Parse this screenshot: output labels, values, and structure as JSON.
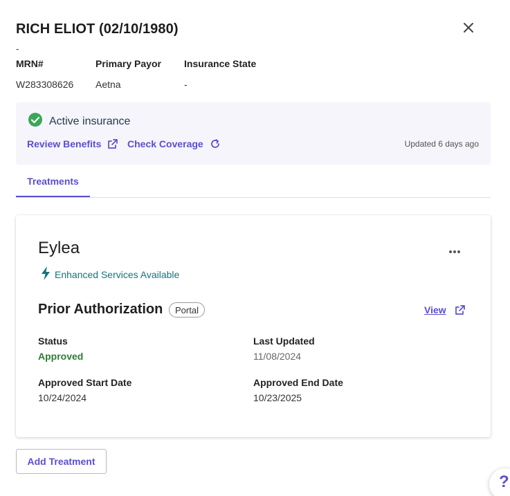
{
  "header": {
    "title": "RICH ELIOT (02/10/1980)",
    "subtitle_dash": "-"
  },
  "patient_info": {
    "mrn_label": "MRN#",
    "mrn_value": "W283308626",
    "payor_label": "Primary Payor",
    "payor_value": "Aetna",
    "state_label": "Insurance State",
    "state_value": "-"
  },
  "insurance": {
    "status": "Active insurance",
    "review_benefits": "Review Benefits",
    "check_coverage": "Check Coverage",
    "updated": "Updated 6 days ago"
  },
  "tabs": [
    {
      "label": "Treatments",
      "active": true
    }
  ],
  "treatment": {
    "drug_name": "Eylea",
    "enhanced": "Enhanced Services Available",
    "pa_title": "Prior Authorization",
    "pa_chip": "Portal",
    "view_label": "View",
    "status_label": "Status",
    "status_value": "Approved",
    "last_updated_label": "Last Updated",
    "last_updated_value": "11/08/2024",
    "start_label": "Approved Start Date",
    "start_value": "10/24/2024",
    "end_label": "Approved End Date",
    "end_value": "10/23/2025"
  },
  "actions": {
    "add_treatment": "Add Treatment",
    "help": "?"
  },
  "colors": {
    "accent": "#5a4fcf",
    "success": "#2e7d32",
    "check_green": "#3aa757",
    "teal": "#12747c",
    "insurance_bg": "#f5f5fb"
  },
  "icons": {
    "close": "close-icon",
    "active_check": "check-circle-icon",
    "external_link": "external-link-icon",
    "refresh": "refresh-icon",
    "more": "more-horizontal-icon",
    "bolt": "lightning-bolt-icon"
  }
}
